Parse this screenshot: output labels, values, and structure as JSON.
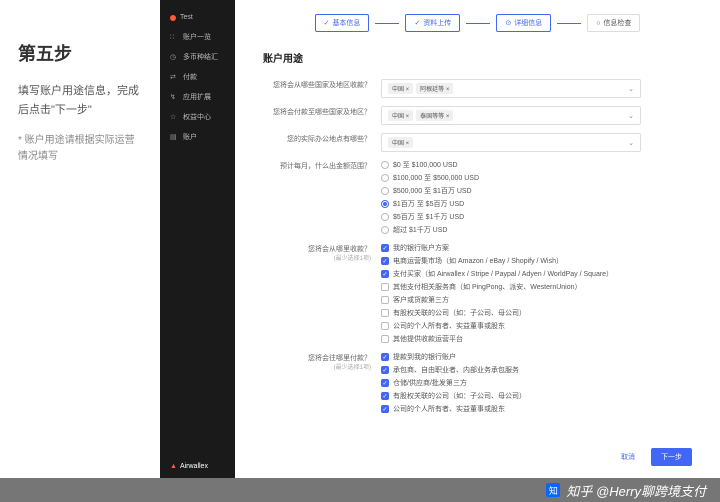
{
  "left": {
    "title": "第五步",
    "desc": "填写账户用途信息，完成后点击\"下一步\"",
    "note": "* 账户用途请根据实际运营情况填写"
  },
  "sidebar": {
    "brand": "Test",
    "items": [
      {
        "icon": "∷",
        "label": "账户一览"
      },
      {
        "icon": "◷",
        "label": "多币种结汇"
      },
      {
        "icon": "⇄",
        "label": "付款"
      },
      {
        "icon": "↯",
        "label": "应用扩展"
      },
      {
        "icon": "☆",
        "label": "权益中心"
      },
      {
        "icon": "▤",
        "label": "账户"
      }
    ],
    "footer_brand": "Airwallex"
  },
  "stepper": [
    {
      "label": "基本信息",
      "state": "done"
    },
    {
      "label": "资料上传",
      "state": "done"
    },
    {
      "label": "详细信息",
      "state": "active"
    },
    {
      "label": "信息检查",
      "state": "pending"
    }
  ],
  "section_title": "账户用途",
  "q_receive_from": {
    "label": "您将会从哪些国家及地区收款？",
    "tags": [
      "中国",
      "阿根廷等"
    ]
  },
  "q_pay_to": {
    "label": "您将会付款至哪些国家及地区？",
    "tags": [
      "中国",
      "泰国等等"
    ]
  },
  "q_company_loc": {
    "label": "您的实际办公地点有哪些？",
    "tags": [
      "中国"
    ]
  },
  "q_monthly_vol": {
    "label": "预计每月，什么出金额范围？",
    "options": [
      {
        "text": "$0 至 $100,000 USD",
        "checked": false
      },
      {
        "text": "$100,000 至 $500,000 USD",
        "checked": false
      },
      {
        "text": "$500,000 至 $1百万 USD",
        "checked": false
      },
      {
        "text": "$1百万 至 $5百万 USD",
        "checked": true
      },
      {
        "text": "$5百万 至 $1千万 USD",
        "checked": false
      },
      {
        "text": "超过 $1千万 USD",
        "checked": false
      }
    ]
  },
  "q_receive_method": {
    "label": "您将会从哪里收款？",
    "sublabel": "(最少选择1项)",
    "options": [
      {
        "text": "我的银行账户方案",
        "checked": true
      },
      {
        "text": "电商运营集市场（如 Amazon / eBay / Shopify / Wish）",
        "checked": true
      },
      {
        "text": "支付买家（如 Airwallex / Stripe / Paypal / Adyen / WorldPay / Square）",
        "checked": true
      },
      {
        "text": "其他支付相关服务商（如 PingPong、派安、WesternUnion）",
        "checked": false
      },
      {
        "text": "客户或货款第三方",
        "checked": false
      },
      {
        "text": "有股权关联的公司（如：子公司、母公司）",
        "checked": false
      },
      {
        "text": "公司的个人所有者、实益董事或股东",
        "checked": false
      },
      {
        "text": "其他提供收款运营平台",
        "checked": false
      }
    ]
  },
  "q_pay_method": {
    "label": "您将会往哪里付款？",
    "sublabel": "(最少选择1项)",
    "options": [
      {
        "text": "提款到我的银行账户",
        "checked": true
      },
      {
        "text": "承包商、自由职业者、内部业务承包服务",
        "checked": true
      },
      {
        "text": "仓储/供应商/批发第三方",
        "checked": true
      },
      {
        "text": "有股权关联的公司（如：子公司、母公司）",
        "checked": true
      },
      {
        "text": "公司的个人所有者、实益董事或股东",
        "checked": true
      }
    ]
  },
  "buttons": {
    "prev": "取消",
    "next": "下一步"
  },
  "watermark": "知乎 @Herry聊跨境支付"
}
